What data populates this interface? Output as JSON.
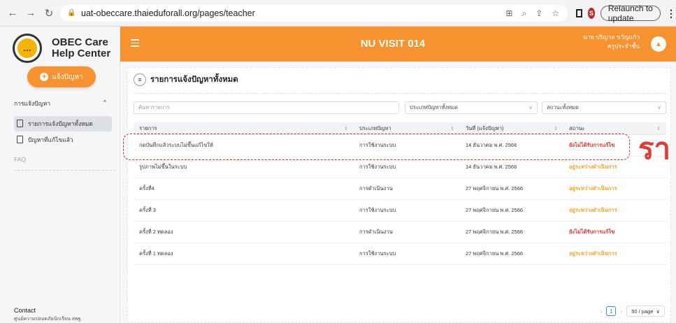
{
  "browser": {
    "url": "uat-obeccare.thaieduforall.org/pages/teacher",
    "profile_initial": "S",
    "relaunch_label": "Relaunch to update"
  },
  "brand": {
    "line1": "OBEC Care",
    "line2": "Help Center"
  },
  "sidebar": {
    "report_button": "แจ้งปัญหา",
    "section_title": "การแจ้งปัญหา",
    "items": [
      {
        "label": "รายการแจ้งปัญหาทั้งหมด"
      },
      {
        "label": "ปัญหาที่แก้ไขแล้ว"
      }
    ],
    "faq": "FAQ",
    "contact_title": "Contact",
    "contact_sub": "ศูนย์ความปลอดภัยนักเรียน สพฐ."
  },
  "header": {
    "title": "NU VISIT 014",
    "user_name": "นาย ปริญาล ขวัญแก้ว",
    "user_role": "ครูประจำชั้น"
  },
  "main": {
    "title": "รายการแจ้งปัญหาทั้งหมด",
    "search_placeholder": "ค้นหารายการ",
    "type_filter": "ประเภทปัญหาทั้งหมด",
    "status_filter": "สถานะทั้งหมด",
    "columns": [
      "รายการ",
      "ประเภทปัญหา",
      "วันที่ (แจ้งปัญหา)",
      "สถานะ"
    ],
    "rows": [
      {
        "item": "กดบันทึกแล้วระบบไม่ขึ้นแก้ไขให้",
        "type": "การใช้งานระบบ",
        "date": "14 ธันวาคม พ.ศ. 2566",
        "status": "ยังไม่ได้รับการแก้ไข",
        "status_kind": "red"
      },
      {
        "item": "รูปภาพไม่ขึ้นในระบบ",
        "type": "การใช้งานระบบ",
        "date": "14 ธันวาคม พ.ศ. 2566",
        "status": "อยู่ระหว่างดำเนินการ",
        "status_kind": "orange"
      },
      {
        "item": "ครั้งที่4",
        "type": "การดำเนินงาน",
        "date": "27 พฤศจิกายน พ.ศ. 2566",
        "status": "อยู่ระหว่างดำเนินการ",
        "status_kind": "orange"
      },
      {
        "item": "ครั้งที่ 3",
        "type": "การใช้งานระบบ",
        "date": "27 พฤศจิกายน พ.ศ. 2566",
        "status": "อยู่ระหว่างดำเนินการ",
        "status_kind": "orange"
      },
      {
        "item": "ครั้งที่ 2 ทดลอง",
        "type": "การดำเนินงาน",
        "date": "27 พฤศจิกายน พ.ศ. 2566",
        "status": "ยังไม่ได้รับการแก้ไข",
        "status_kind": "red"
      },
      {
        "item": "ครั้งที่ 1 ทดลอง",
        "type": "การใช้งานระบบ",
        "date": "27 พฤศจิกายน พ.ศ. 2566",
        "status": "อยู่ระหว่างดำเนินการ",
        "status_kind": "orange"
      }
    ],
    "pagination": {
      "current": "1",
      "page_size": "50 / page"
    }
  },
  "annotation": {
    "text": "รา"
  },
  "colors": {
    "brand_orange": "#f7922e",
    "status_red": "#e53935",
    "status_orange": "#f5a623"
  }
}
